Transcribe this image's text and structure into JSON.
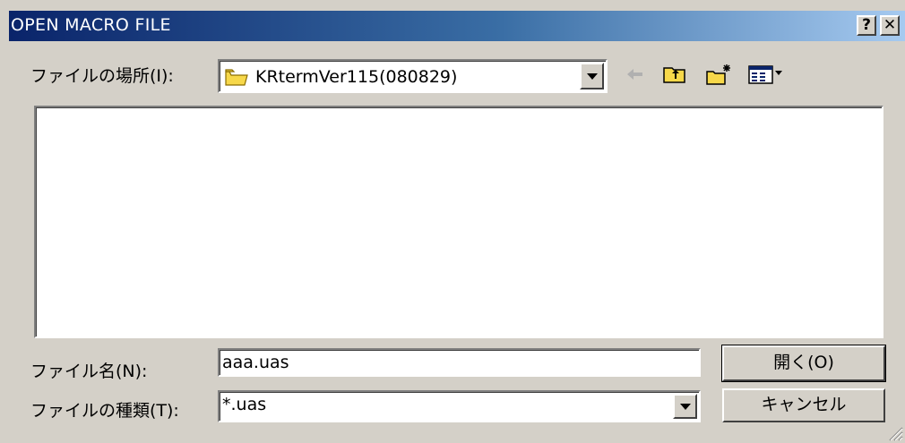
{
  "window": {
    "title": "OPEN MACRO FILE",
    "help_label": "?",
    "close_label": "✕"
  },
  "lookin": {
    "label": "ファイルの場所(I):",
    "value": "KRtermVer115(080829)",
    "icon": "folder-icon"
  },
  "toolbar": {
    "icons": [
      "back-arrow-icon",
      "up-folder-icon",
      "new-folder-icon",
      "views-menu-icon"
    ]
  },
  "filename": {
    "label": "ファイル名(N):",
    "value": "aaa.uas"
  },
  "filetype": {
    "label": "ファイルの種類(T):",
    "value": "*.uas"
  },
  "buttons": {
    "open": "開く(O)",
    "cancel": "キャンセル"
  },
  "colors": {
    "title_start": "#0a246a",
    "title_end": "#a6caf0",
    "dialog_bg": "#d4d0c8"
  }
}
